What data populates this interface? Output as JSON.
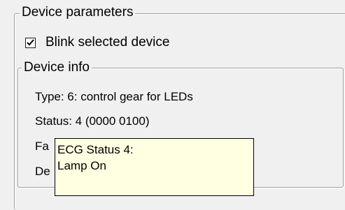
{
  "device_parameters": {
    "group_title": "Device parameters",
    "blink_checkbox": {
      "label": "Blink selected device",
      "checked": true
    }
  },
  "device_info": {
    "group_title": "Device info",
    "type_line": "Type: 6: control gear for LEDs",
    "status_line": "Status: 4 (0000 0100)",
    "partial_line_1": "Fa",
    "partial_line_2": "De"
  },
  "tooltip": {
    "line1": "ECG Status 4:",
    "line2": "Lamp On"
  }
}
